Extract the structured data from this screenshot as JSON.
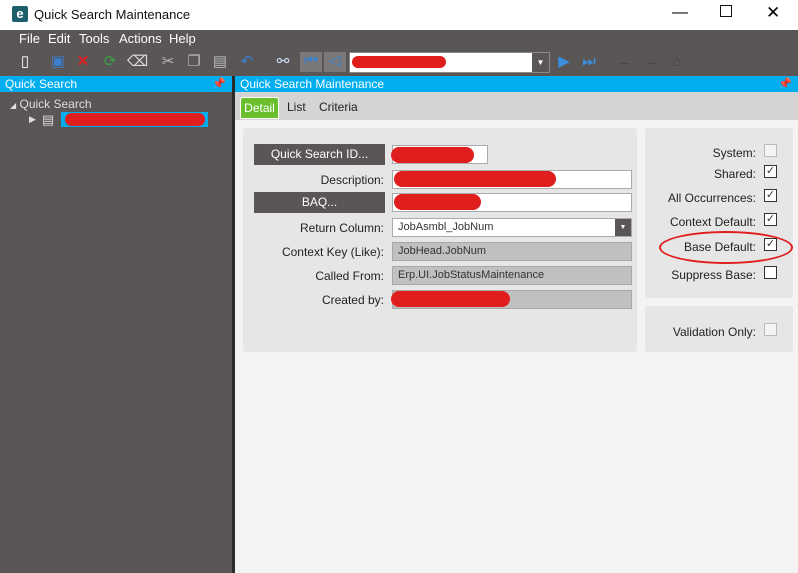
{
  "window": {
    "title": "Quick Search Maintenance",
    "controls": [
      "minimize",
      "maximize",
      "close"
    ]
  },
  "menu": [
    "File",
    "Edit",
    "Tools",
    "Actions",
    "Help"
  ],
  "toolbar": {
    "icons": [
      "new-icon",
      "save-icon",
      "delete-icon",
      "refresh-icon",
      "clear-icon",
      "cut-icon",
      "copy-icon",
      "paste-icon",
      "undo-icon",
      "search-icon",
      "first-record-icon",
      "previous-record-icon",
      "next-record-icon",
      "last-record-icon",
      "back-icon",
      "forward-icon",
      "home-icon"
    ]
  },
  "left_panel": {
    "title": "Quick Search",
    "tree_root": "Quick Search"
  },
  "right_panel": {
    "title": "Quick Search Maintenance",
    "tabs": [
      "Detail",
      "List",
      "Criteria"
    ],
    "active_tab": "Detail"
  },
  "form": {
    "quick_search_id_button": "Quick Search ID...",
    "description_label": "Description:",
    "baq_button": "BAQ...",
    "return_column_label": "Return Column:",
    "return_column_value": "JobAsmbl_JobNum",
    "context_key_label": "Context Key (Like):",
    "context_key_value": "JobHead.JobNum",
    "called_from_label": "Called From:",
    "called_from_value": "Erp.UI.JobStatusMaintenance",
    "created_by_label": "Created by:"
  },
  "flags": [
    {
      "label": "System:",
      "checked": false,
      "enabled": false
    },
    {
      "label": "Shared:",
      "checked": true,
      "enabled": true
    },
    {
      "label": "All Occurrences:",
      "checked": true,
      "enabled": true
    },
    {
      "label": "Context Default:",
      "checked": true,
      "enabled": true
    },
    {
      "label": "Base Default:",
      "checked": true,
      "enabled": true
    },
    {
      "label": "Suppress Base:",
      "checked": false,
      "enabled": true
    }
  ],
  "validation_only": {
    "label": "Validation Only:",
    "checked": false,
    "enabled": false
  },
  "colors": {
    "accent": "#00adef",
    "chrome": "#595655",
    "active_tab": "#6cbf2c",
    "annotation": "#e01e1e"
  }
}
